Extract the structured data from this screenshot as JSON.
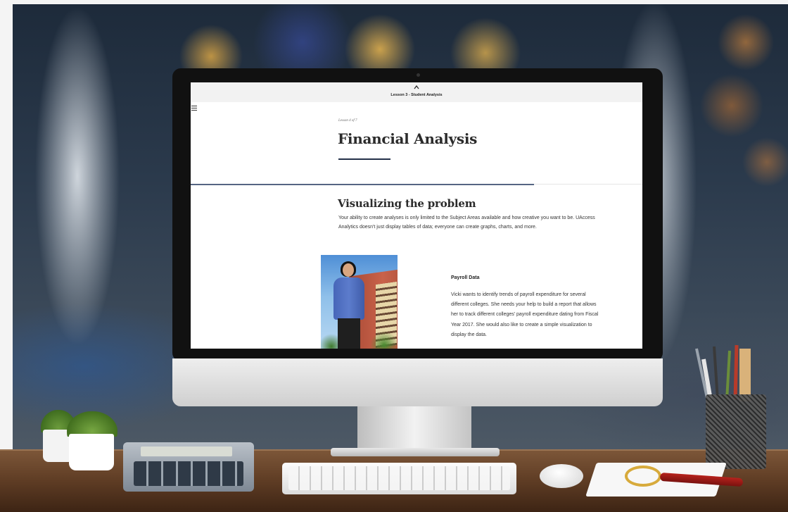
{
  "course": {
    "lesson_bar_title": "Lesson 3 - Student Analysis"
  },
  "lesson": {
    "counter": "Lesson 4 of 7",
    "title": "Financial Analysis",
    "progress_fraction": 0.76
  },
  "section": {
    "title": "Visualizing the problem",
    "intro": "Your ability to create analyses is only limited to the Subject Areas available and how creative you want to be. UAccess Analytics doesn't just display tables of data; everyone can create graphs, charts, and more."
  },
  "card": {
    "title": "Payroll Data",
    "text": "Vicki wants to identify trends of payroll expenditure for several different colleges. She needs your help to build a report that allows her to track different colleges' payroll expenditure dating from Fiscal Year 2017. She would also like to create a simple visualization to display the data."
  },
  "icons": {
    "lesson_bar_toggle": "chevron-up-icon",
    "menu": "hamburger-menu-icon"
  },
  "colors": {
    "accent": "#23314a",
    "progress": "#556583"
  }
}
